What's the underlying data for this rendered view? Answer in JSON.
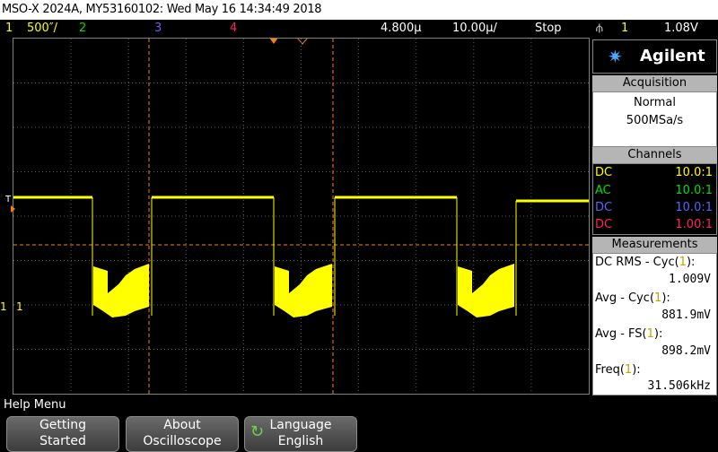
{
  "title": "MSO-X 2024A, MY53160102: Wed May 16 14:34:49 2018",
  "status": {
    "ch1_num": "1",
    "ch1_scale": "500″/",
    "ch2_num": "2",
    "ch3_num": "3",
    "ch4_num": "4",
    "time_delay": "4.800µ",
    "time_scale": "10.00µ/",
    "run_state": "Stop",
    "trigger_src": "1",
    "trigger_level": "1.08V"
  },
  "brand": "Agilent",
  "acquisition": {
    "header": "Acquisition",
    "mode": "Normal",
    "rate": "500MSa/s"
  },
  "channels": {
    "header": "Channels",
    "rows": [
      {
        "coupling": "DC",
        "ratio": "10.0:1",
        "color": "#ffff00"
      },
      {
        "coupling": "AC",
        "ratio": "10.0:1",
        "color": "#00e000"
      },
      {
        "coupling": "DC",
        "ratio": "10.0:1",
        "color": "#6060ff"
      },
      {
        "coupling": "DC",
        "ratio": "1.00:1",
        "color": "#ff2060"
      }
    ]
  },
  "measurements": {
    "header": "Measurements",
    "items": [
      {
        "label": "DC RMS - Cyc(",
        "src": "1",
        "close": "):",
        "value": "1.009V"
      },
      {
        "label": "Avg - Cyc(",
        "src": "1",
        "close": "):",
        "value": "881.9mV"
      },
      {
        "label": "Avg - FS(",
        "src": "1",
        "close": "):",
        "value": "898.2mV"
      },
      {
        "label": "Freq(",
        "src": "1",
        "close": "):",
        "value": "31.506kHz"
      }
    ]
  },
  "screen_markers": {
    "trigger_marker": "T",
    "ground_marker": "1"
  },
  "help_menu": "Help Menu",
  "softkeys": [
    {
      "line1": "Getting",
      "line2": "Started"
    },
    {
      "line1": "About",
      "line2": "Oscilloscope"
    },
    {
      "line1": "Language",
      "line2": "English"
    }
  ],
  "colors": {
    "ch1": "#ffff00",
    "ch2": "#00e000",
    "ch3": "#6060ff",
    "ch4": "#ff2060",
    "cursor": "#ff8000"
  }
}
